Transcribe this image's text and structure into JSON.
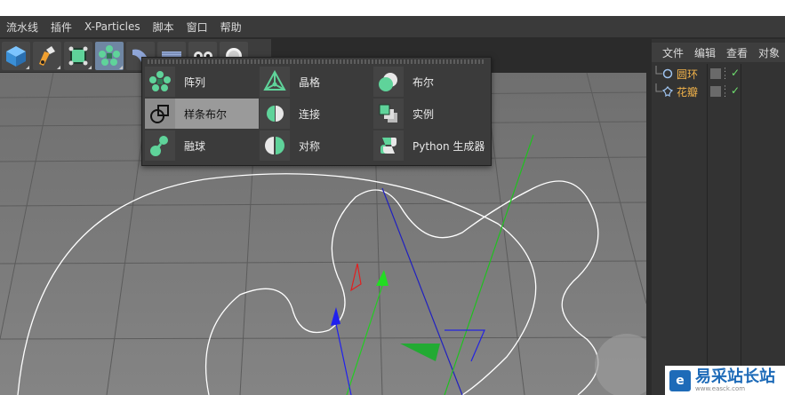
{
  "menubar": {
    "items": [
      "流水线",
      "插件",
      "X-Particles",
      "脚本",
      "窗口",
      "帮助"
    ]
  },
  "toolbar": {
    "buttons": [
      "cube-icon",
      "pen-icon",
      "subdivision-icon",
      "array-icon",
      "bend-icon",
      "plane-icon",
      "camera-icon",
      "light-icon"
    ]
  },
  "popup": {
    "items": [
      {
        "label": "阵列",
        "icon": "array-icon"
      },
      {
        "label": "晶格",
        "icon": "lattice-icon"
      },
      {
        "label": "布尔",
        "icon": "boolean-icon"
      },
      {
        "label": "样条布尔",
        "icon": "spline-boolean-icon"
      },
      {
        "label": "连接",
        "icon": "connect-icon"
      },
      {
        "label": "实例",
        "icon": "instance-icon"
      },
      {
        "label": "融球",
        "icon": "metaball-icon"
      },
      {
        "label": "对称",
        "icon": "symmetry-icon"
      },
      {
        "label": "Python 生成器",
        "icon": "python-icon"
      }
    ]
  },
  "object_manager": {
    "menu": [
      "文件",
      "编辑",
      "查看",
      "对象"
    ],
    "objects": [
      {
        "name": "圆环",
        "icon": "circle-icon"
      },
      {
        "name": "花瓣",
        "icon": "flower-icon"
      }
    ]
  },
  "watermark": {
    "logo": "e",
    "title": "易采站长站",
    "sub": "www.easck.com"
  },
  "colors": {
    "accent": "#6f86a3",
    "object_name": "#f2b34a",
    "generator_green": "#5fd39a"
  }
}
